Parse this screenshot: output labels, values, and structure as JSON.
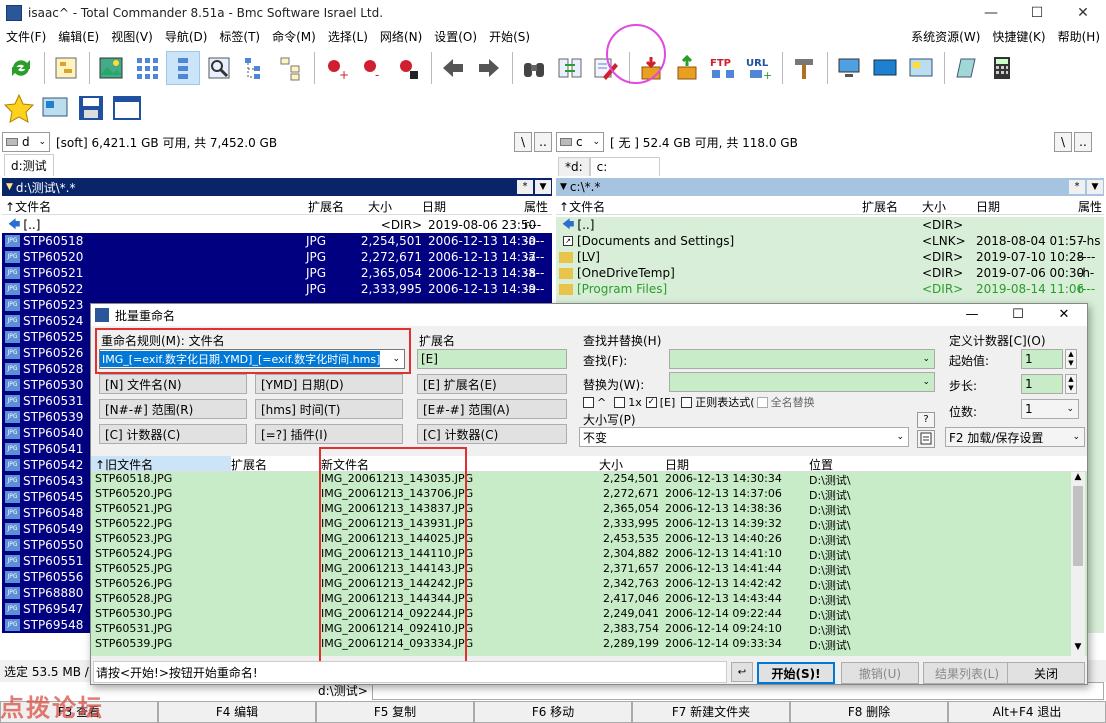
{
  "window": {
    "title": "isaac^ - Total Commander 8.51a - Bmc Software Israel Ltd.",
    "min": "—",
    "max": "☐",
    "close": "✕"
  },
  "menu": {
    "left": [
      "文件(F)",
      "编辑(E)",
      "视图(V)",
      "导航(D)",
      "标签(T)",
      "命令(M)",
      "选择(L)",
      "网络(N)",
      "设置(O)",
      "开始(S)"
    ],
    "right": [
      "系统资源(W)",
      "快捷键(K)",
      "帮助(H)"
    ]
  },
  "toolbar": {
    "icons": [
      "refresh-icon",
      "tree-icon",
      "thumbnails-icon",
      "brief-icon",
      "detailed-icon",
      "quickview-icon",
      "tree-view-icon",
      "branch-view-icon",
      "select-plus-icon",
      "select-minus-icon",
      "invert-select-icon",
      "back-icon",
      "forward-icon",
      "find-icon",
      "sync-icon",
      "multi-rename-icon",
      "unpack-icon",
      "pack-icon",
      "extract-icon",
      "ftp-icon",
      "url-icon",
      "tools-icon",
      "network-icon",
      "desktop-icon",
      "control-panel-icon",
      "notepad-icon",
      "calculator-icon"
    ],
    "ftp_label": "FTP",
    "url_label": "URL"
  },
  "left": {
    "drive": "d",
    "drive_info": "[soft]  6,421.1 GB 可用, 共 7,452.0 GB",
    "tab": "d:测试",
    "path": "d:\\测试\\*.*",
    "btn_root": "\\",
    "btn_up": "..",
    "headers": {
      "name": "文件名",
      "ext": "扩展名",
      "size": "大小",
      "date": "日期",
      "attr": "属性"
    },
    "rows": [
      {
        "name": "[..]",
        "ext": "",
        "size": "<DIR>",
        "date": "2019-08-06 23:50",
        "attr": "r---",
        "type": "up"
      },
      {
        "name": "STP60518",
        "ext": "JPG",
        "size": "2,254,501",
        "date": "2006-12-13 14:30",
        "attr": "-a--",
        "type": "sel"
      },
      {
        "name": "STP60520",
        "ext": "JPG",
        "size": "2,272,671",
        "date": "2006-12-13 14:37",
        "attr": "-a--",
        "type": "sel"
      },
      {
        "name": "STP60521",
        "ext": "JPG",
        "size": "2,365,054",
        "date": "2006-12-13 14:38",
        "attr": "-a--",
        "type": "sel"
      },
      {
        "name": "STP60522",
        "ext": "JPG",
        "size": "2,333,995",
        "date": "2006-12-13 14:39",
        "attr": "-a--",
        "type": "sel"
      },
      {
        "name": "STP60523",
        "ext": "",
        "size": "",
        "date": "",
        "attr": "",
        "type": "sel"
      },
      {
        "name": "STP60524",
        "ext": "",
        "size": "",
        "date": "",
        "attr": "",
        "type": "sel"
      },
      {
        "name": "STP60525",
        "ext": "",
        "size": "",
        "date": "",
        "attr": "",
        "type": "sel"
      },
      {
        "name": "STP60526",
        "ext": "",
        "size": "",
        "date": "",
        "attr": "",
        "type": "sel"
      },
      {
        "name": "STP60528",
        "ext": "",
        "size": "",
        "date": "",
        "attr": "",
        "type": "sel"
      },
      {
        "name": "STP60530",
        "ext": "",
        "size": "",
        "date": "",
        "attr": "",
        "type": "sel"
      },
      {
        "name": "STP60531",
        "ext": "",
        "size": "",
        "date": "",
        "attr": "",
        "type": "sel"
      },
      {
        "name": "STP60539",
        "ext": "",
        "size": "",
        "date": "",
        "attr": "",
        "type": "sel"
      },
      {
        "name": "STP60540",
        "ext": "",
        "size": "",
        "date": "",
        "attr": "",
        "type": "sel"
      },
      {
        "name": "STP60541",
        "ext": "",
        "size": "",
        "date": "",
        "attr": "",
        "type": "sel"
      },
      {
        "name": "STP60542",
        "ext": "",
        "size": "",
        "date": "",
        "attr": "",
        "type": "sel"
      },
      {
        "name": "STP60543",
        "ext": "",
        "size": "",
        "date": "",
        "attr": "",
        "type": "sel"
      },
      {
        "name": "STP60545",
        "ext": "",
        "size": "",
        "date": "",
        "attr": "",
        "type": "sel"
      },
      {
        "name": "STP60548",
        "ext": "",
        "size": "",
        "date": "",
        "attr": "",
        "type": "sel"
      },
      {
        "name": "STP60549",
        "ext": "",
        "size": "",
        "date": "",
        "attr": "",
        "type": "sel"
      },
      {
        "name": "STP60550",
        "ext": "",
        "size": "",
        "date": "",
        "attr": "",
        "type": "sel"
      },
      {
        "name": "STP60551",
        "ext": "",
        "size": "",
        "date": "",
        "attr": "",
        "type": "sel"
      },
      {
        "name": "STP60556",
        "ext": "",
        "size": "",
        "date": "",
        "attr": "",
        "type": "sel"
      },
      {
        "name": "STP68880",
        "ext": "",
        "size": "",
        "date": "",
        "attr": "",
        "type": "sel"
      },
      {
        "name": "STP69547",
        "ext": "",
        "size": "",
        "date": "",
        "attr": "",
        "type": "sel"
      },
      {
        "name": "STP69548",
        "ext": "",
        "size": "",
        "date": "",
        "attr": "",
        "type": "sel"
      }
    ]
  },
  "right": {
    "drive": "c",
    "drive_info": "[ 无 ]  52.4 GB 可用, 共 118.0 GB",
    "tab1": "*d:",
    "tab2": "c:",
    "path": "c:\\*.*",
    "btn_root": "\\",
    "btn_up": "..",
    "rows": [
      {
        "name": "[..]",
        "ext": "",
        "size": "<DIR>",
        "date": "",
        "attr": "",
        "type": "up"
      },
      {
        "name": "[Documents and Settings]",
        "ext": "",
        "size": "<LNK>",
        "date": "2018-08-04 01:57",
        "attr": "--hs",
        "type": "lnk"
      },
      {
        "name": "[LV]",
        "ext": "",
        "size": "<DIR>",
        "date": "2019-07-10 10:28",
        "attr": "----",
        "type": "dir"
      },
      {
        "name": "[OneDriveTemp]",
        "ext": "",
        "size": "<DIR>",
        "date": "2019-07-06 00:30",
        "attr": "-h-",
        "type": "dir"
      },
      {
        "name": "[Program Files]",
        "ext": "",
        "size": "<DIR>",
        "date": "2019-08-14 11:06",
        "attr": "r---",
        "type": "dirg"
      }
    ]
  },
  "dialog": {
    "title": "批量重命名",
    "rule_label": "重命名规则(M): 文件名",
    "rule_value": "IMG_[=exif.数字化日期.YMD]_[=exif.数字化时间.hms]",
    "ext_label": "扩展名",
    "ext_value": "[E]",
    "btn_name": "[N] 文件名(N)",
    "btn_range": "[N#-#] 范围(R)",
    "btn_counter": "[C] 计数器(C)",
    "btn_date": "[YMD] 日期(D)",
    "btn_time": "[hms] 时间(T)",
    "btn_plugin": "[=?] 插件(I)",
    "btn_ext": "[E] 扩展名(E)",
    "btn_ext_range": "[E#-#] 范围(A)",
    "btn_ext_counter": "[C] 计数器(C)",
    "find_section": "查找并替换(H)",
    "find_label": "查找(F):",
    "replace_label": "替换为(W):",
    "opt_caret": "^",
    "opt_1x": "1x",
    "opt_e": "[E]",
    "opt_regex": "正则表达式(",
    "opt_full": "全名替换",
    "case_label": "大小写(P)",
    "case_value": "不变",
    "question": "?",
    "counter_section": "定义计数器[C](O)",
    "start_label": "起始值:",
    "start_value": "1",
    "step_label": "步长:",
    "step_value": "1",
    "digits_label": "位数:",
    "digits_value": "1",
    "f2_label": "F2 加载/保存设置",
    "headers": {
      "old": "旧文件名",
      "ext": "扩展名",
      "new": "新文件名",
      "size": "大小",
      "date": "日期",
      "loc": "位置"
    },
    "rows": [
      {
        "old": "STP60518.JPG",
        "new": "IMG_20061213_143035.JPG",
        "size": "2,254,501",
        "date": "2006-12-13 14:30:34",
        "loc": "D:\\测试\\"
      },
      {
        "old": "STP60520.JPG",
        "new": "IMG_20061213_143706.JPG",
        "size": "2,272,671",
        "date": "2006-12-13 14:37:06",
        "loc": "D:\\测试\\"
      },
      {
        "old": "STP60521.JPG",
        "new": "IMG_20061213_143837.JPG",
        "size": "2,365,054",
        "date": "2006-12-13 14:38:36",
        "loc": "D:\\测试\\"
      },
      {
        "old": "STP60522.JPG",
        "new": "IMG_20061213_143931.JPG",
        "size": "2,333,995",
        "date": "2006-12-13 14:39:32",
        "loc": "D:\\测试\\"
      },
      {
        "old": "STP60523.JPG",
        "new": "IMG_20061213_144025.JPG",
        "size": "2,453,535",
        "date": "2006-12-13 14:40:26",
        "loc": "D:\\测试\\"
      },
      {
        "old": "STP60524.JPG",
        "new": "IMG_20061213_144110.JPG",
        "size": "2,304,882",
        "date": "2006-12-13 14:41:10",
        "loc": "D:\\测试\\"
      },
      {
        "old": "STP60525.JPG",
        "new": "IMG_20061213_144143.JPG",
        "size": "2,371,657",
        "date": "2006-12-13 14:41:44",
        "loc": "D:\\测试\\"
      },
      {
        "old": "STP60526.JPG",
        "new": "IMG_20061213_144242.JPG",
        "size": "2,342,763",
        "date": "2006-12-13 14:42:42",
        "loc": "D:\\测试\\"
      },
      {
        "old": "STP60528.JPG",
        "new": "IMG_20061213_144344.JPG",
        "size": "2,417,046",
        "date": "2006-12-13 14:43:44",
        "loc": "D:\\测试\\"
      },
      {
        "old": "STP60530.JPG",
        "new": "IMG_20061214_092244.JPG",
        "size": "2,249,041",
        "date": "2006-12-14 09:22:44",
        "loc": "D:\\测试\\"
      },
      {
        "old": "STP60531.JPG",
        "new": "IMG_20061214_092410.JPG",
        "size": "2,383,754",
        "date": "2006-12-14 09:24:10",
        "loc": "D:\\测试\\"
      },
      {
        "old": "STP60539.JPG",
        "new": "IMG_20061214_093334.JPG",
        "size": "2,289,199",
        "date": "2006-12-14 09:33:34",
        "loc": "D:\\测试\\"
      }
    ],
    "status": "请按<开始!>按钮开始重命名!",
    "btn_start": "开始(S)!",
    "btn_undo": "撤销(U)",
    "btn_result": "结果列表(L)",
    "btn_close": "关闭"
  },
  "status": {
    "left": "选定 53.5 MB /",
    "cmd_path": "d:\\测试>"
  },
  "fkeys": [
    "F3 查看",
    "F4 编辑",
    "F5 复制",
    "F6 移动",
    "F7 新建文件夹",
    "F8 删除",
    "Alt+F4 退出"
  ],
  "watermark": "点拨论坛"
}
